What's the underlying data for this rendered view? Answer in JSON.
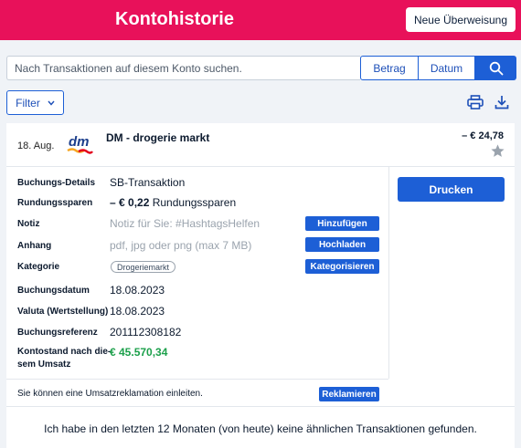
{
  "header": {
    "title": "Kontohistorie",
    "new_transfer_label": "Neue Überweisung",
    "brand_color": "#e8115a"
  },
  "search": {
    "placeholder": "Nach Transaktionen auf diesem Konto suchen.",
    "sort_amount_label": "Betrag",
    "sort_date_label": "Datum",
    "search_icon": "search-icon"
  },
  "toolbar": {
    "filter_label": "Filter",
    "print_icon": "printer-icon",
    "download_icon": "download-icon"
  },
  "transaction": {
    "date": "18. Aug.",
    "logo_text": "dm",
    "merchant": "DM - drogerie markt",
    "amount": "– € 24,78",
    "favorite_icon": "star-icon",
    "print_label": "Drucken",
    "details": {
      "booking_details_label": "Buchungs-Details",
      "booking_details_value": "SB-Transaktion",
      "roundup_label": "Rundungssparen",
      "roundup_amount": "– € 0,22",
      "roundup_text": "Rundungssparen",
      "note_label": "Notiz",
      "note_placeholder": "Notiz für Sie: #HashtagsHelfen",
      "note_button": "Hinzufügen",
      "attachment_label": "Anhang",
      "attachment_placeholder": "pdf, jpg oder png (max 7 MB)",
      "attachment_button": "Hochladen",
      "category_label": "Kategorie",
      "category_value": "Drogeriemarkt",
      "category_button": "Kategorisieren",
      "booking_date_label": "Buchungsdatum",
      "booking_date_value": "18.08.2023",
      "value_date_label": "Valuta (Wertstellung)",
      "value_date_value": "18.08.2023",
      "reference_label": "Buchungsreferenz",
      "reference_value": "201112308182",
      "balance_label_line1": "Kontostand nach die-",
      "balance_label_line2": "sem Umsatz",
      "balance_value": "€ 45.570,34"
    },
    "complaint_text": "Sie können eine Umsatzreklamation einleiten.",
    "complaint_button": "Reklamieren",
    "similar_text": "Ich habe in den letzten 12 Monaten (von heute) keine ähnlichen Transaktionen gefunden."
  }
}
